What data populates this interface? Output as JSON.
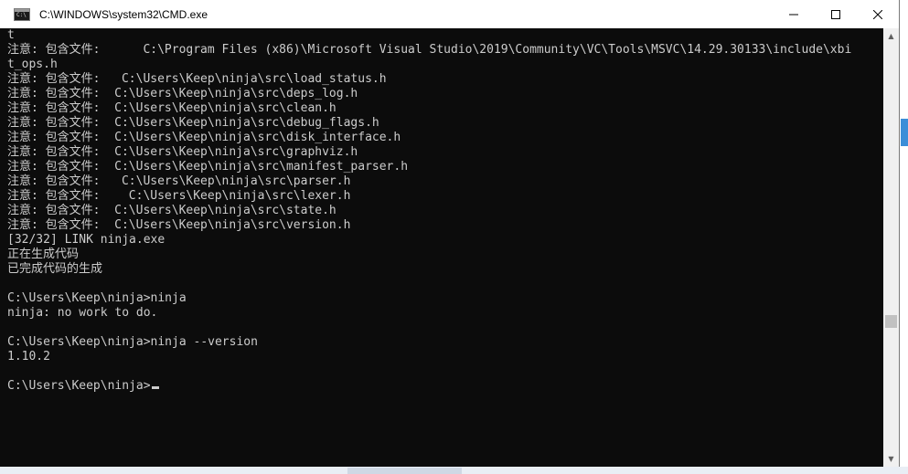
{
  "window": {
    "title": "C:\\WINDOWS\\system32\\CMD.exe"
  },
  "titlebar_icons": {
    "app": "cmd-app-icon",
    "minimize": "minimize-icon",
    "maximize": "maximize-icon",
    "close": "close-icon"
  },
  "console": {
    "lines": [
      "t",
      "注意: 包含文件:      C:\\Program Files (x86)\\Microsoft Visual Studio\\2019\\Community\\VC\\Tools\\MSVC\\14.29.30133\\include\\xbi",
      "t_ops.h",
      "注意: 包含文件:   C:\\Users\\Keep\\ninja\\src\\load_status.h",
      "注意: 包含文件:  C:\\Users\\Keep\\ninja\\src\\deps_log.h",
      "注意: 包含文件:  C:\\Users\\Keep\\ninja\\src\\clean.h",
      "注意: 包含文件:  C:\\Users\\Keep\\ninja\\src\\debug_flags.h",
      "注意: 包含文件:  C:\\Users\\Keep\\ninja\\src\\disk_interface.h",
      "注意: 包含文件:  C:\\Users\\Keep\\ninja\\src\\graphviz.h",
      "注意: 包含文件:  C:\\Users\\Keep\\ninja\\src\\manifest_parser.h",
      "注意: 包含文件:   C:\\Users\\Keep\\ninja\\src\\parser.h",
      "注意: 包含文件:    C:\\Users\\Keep\\ninja\\src\\lexer.h",
      "注意: 包含文件:  C:\\Users\\Keep\\ninja\\src\\state.h",
      "注意: 包含文件:  C:\\Users\\Keep\\ninja\\src\\version.h",
      "[32/32] LINK ninja.exe",
      "正在生成代码",
      "已完成代码的生成",
      "",
      "C:\\Users\\Keep\\ninja>ninja",
      "ninja: no work to do.",
      "",
      "C:\\Users\\Keep\\ninja>ninja --version",
      "1.10.2",
      "",
      "C:\\Users\\Keep\\ninja>"
    ]
  },
  "colors": {
    "console_bg": "#0c0c0c",
    "console_fg": "#cccccc",
    "titlebar_bg": "#ffffff"
  }
}
